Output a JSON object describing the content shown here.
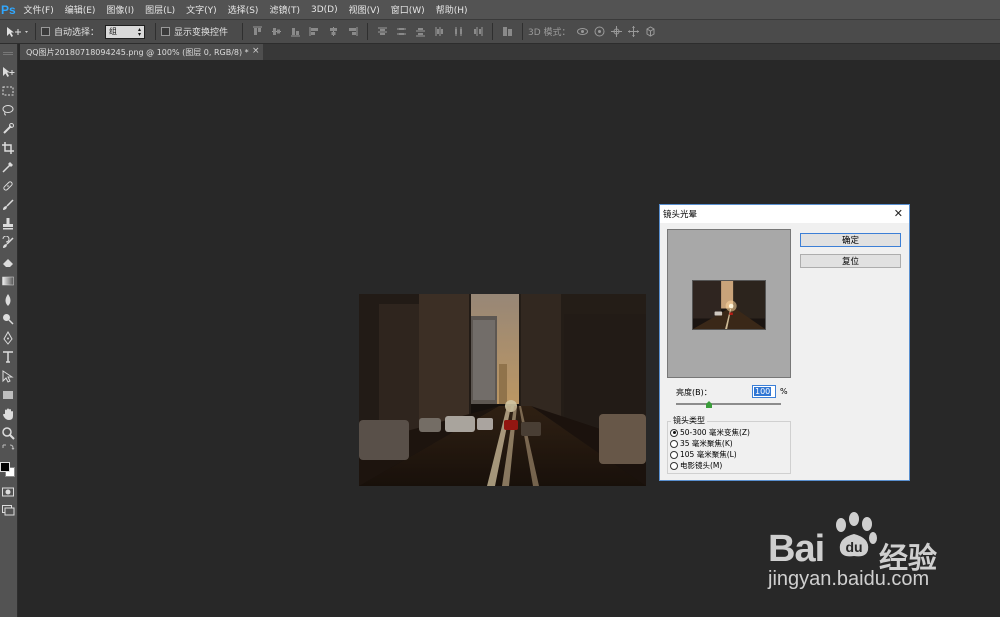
{
  "app": {
    "logo": "Ps",
    "accent": "#31a8ff"
  },
  "menu": [
    "文件(F)",
    "编辑(E)",
    "图像(I)",
    "图层(L)",
    "文字(Y)",
    "选择(S)",
    "滤镜(T)",
    "3D(D)",
    "视图(V)",
    "窗口(W)",
    "帮助(H)"
  ],
  "options": {
    "auto_select_label": "自动选择：",
    "auto_select_value": "组",
    "show_transform_label": "显示变换控件",
    "mode_3d_label": "3D 模式："
  },
  "document": {
    "tab_title": "QQ图片20180718094245.png @ 100% (图层 0, RGB/8) *",
    "close_glyph": "×"
  },
  "dialog": {
    "title": "镜头光晕",
    "close_glyph": "✕",
    "ok_label": "确定",
    "reset_label": "复位",
    "brightness_label": "亮度(B)：",
    "brightness_value": "100",
    "brightness_unit": "%",
    "lens_type_label": "镜头类型",
    "lens_options": [
      "50-300 毫米变焦(Z)",
      "35 毫米聚焦(K)",
      "105 毫米聚焦(L)",
      "电影镜头(M)"
    ],
    "selected_lens": 0
  },
  "watermark": {
    "brand": "Bai",
    "brand_cn": "经验",
    "url": "jingyan.baidu.com"
  }
}
